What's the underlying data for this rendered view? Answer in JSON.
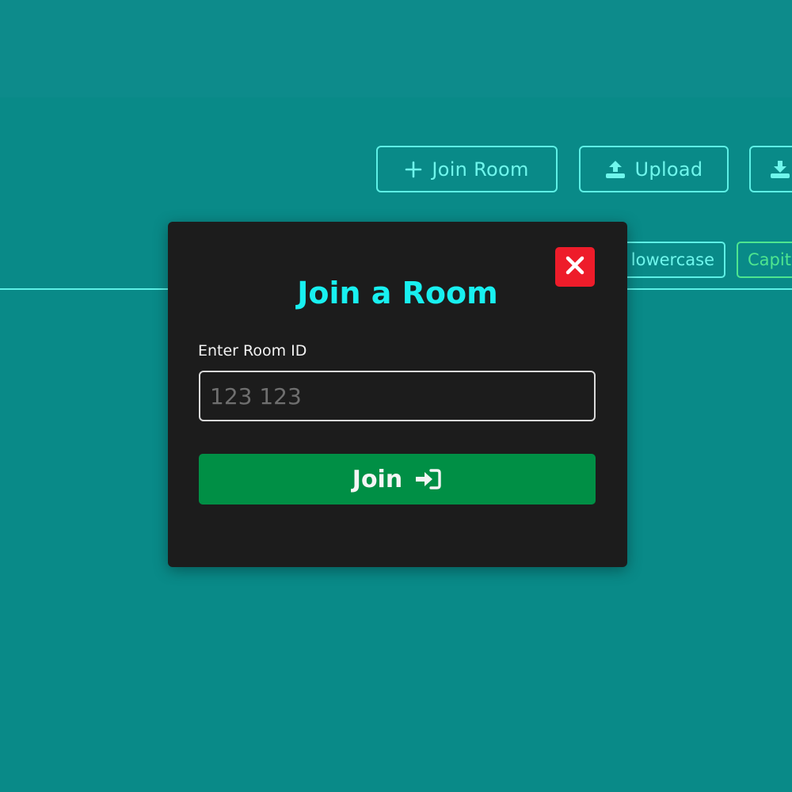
{
  "toolbar": {
    "join_room_label": "Join Room",
    "upload_label": "Upload",
    "join_room_icon": "plus-icon",
    "upload_icon": "upload-icon",
    "download_icon": "download-icon"
  },
  "format_chips": {
    "lowercase_label": "lowercase",
    "capitalize_label": "Capit"
  },
  "modal": {
    "title": "Join a Room",
    "room_id_label": "Enter Room ID",
    "room_id_placeholder": "123 123",
    "room_id_value": "",
    "join_label": "Join",
    "join_icon": "sign-in-icon",
    "close_icon": "close-icon"
  },
  "colors": {
    "background": "#098a88",
    "topbar": "#0d8b8b",
    "accent_cyan": "#18f0f0",
    "modal_bg": "#1c1c1c",
    "join_green": "#008f45",
    "close_red": "#ee1c2a"
  }
}
